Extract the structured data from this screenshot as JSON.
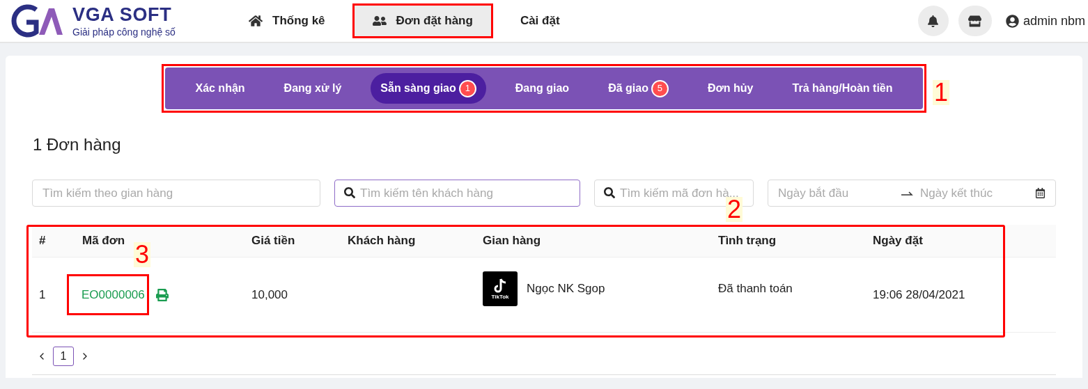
{
  "brand": {
    "name": "VGA SOFT",
    "tagline": "Giải pháp công nghệ số"
  },
  "nav": [
    {
      "label": "Thống kê",
      "selected": false,
      "marked": false
    },
    {
      "label": "Đơn đặt hàng",
      "selected": true,
      "marked": true
    },
    {
      "label": "Cài đặt",
      "selected": false,
      "marked": false
    }
  ],
  "user": {
    "name": "admin nbm"
  },
  "status_tabs": {
    "marked": true,
    "annotation": "1",
    "items": [
      {
        "label": "Xác nhận",
        "selected": false
      },
      {
        "label": "Đang xử lý",
        "selected": false
      },
      {
        "label": "Sẵn sàng giao",
        "selected": true,
        "badge": "1"
      },
      {
        "label": "Đang giao",
        "selected": false
      },
      {
        "label": "Đã giao",
        "selected": false,
        "badge": "5"
      },
      {
        "label": "Đơn hủy",
        "selected": false
      },
      {
        "label": "Trả hàng/Hoàn tiền",
        "selected": false
      }
    ]
  },
  "heading": "1 Đơn hàng",
  "filters": [
    {
      "kind": "text",
      "placeholder": "Tìm kiếm theo gian hàng",
      "focused": false
    },
    {
      "kind": "search",
      "placeholder": "Tìm kiếm tên khách hàng",
      "focused": true
    },
    {
      "kind": "search",
      "placeholder": "Tìm kiếm mã đơn hà...",
      "focused": false
    },
    {
      "kind": "daterange",
      "start_placeholder": "Ngày bắt đầu",
      "end_placeholder": "Ngày kết thúc"
    }
  ],
  "table": {
    "annotation": "2",
    "columns": [
      "#",
      "Mã đơn",
      "Giá tiền",
      "Khách hàng",
      "Gian hàng",
      "Tình trạng",
      "Ngày đặt"
    ],
    "rows": [
      {
        "index": "1",
        "code": "EO0000006",
        "code_annotation": "3",
        "price": "10,000",
        "shop": {
          "logo_text": "TikTok",
          "name": "Ngọc NK Sgop"
        },
        "status": "Đã thanh toán",
        "date": "19:06 28/04/2021"
      }
    ]
  },
  "pagination": {
    "pages": [
      {
        "label": "1",
        "selected": true
      }
    ]
  }
}
